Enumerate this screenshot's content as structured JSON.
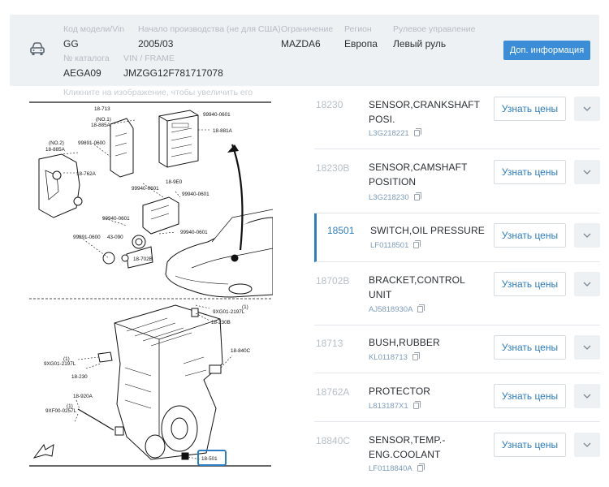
{
  "header": {
    "icon": "car-icon",
    "fields": [
      {
        "id": "model_code",
        "label": "Код модели/Vin",
        "value": "GG"
      },
      {
        "id": "production_start",
        "label": "Начало производства (не для США)",
        "value": "2005/03"
      },
      {
        "id": "restriction",
        "label": "Ограничение",
        "value": "MAZDA6"
      },
      {
        "id": "region",
        "label": "Регион",
        "value": "Европа"
      },
      {
        "id": "steering",
        "label": "Рулевое управление",
        "value": "Левый руль"
      },
      {
        "id": "catalog_no",
        "label": "№ каталога",
        "value": "AEGA09"
      },
      {
        "id": "vin",
        "label": "VIN / FRAME",
        "value": "JMZGG12F781717078"
      }
    ],
    "more_info_button": "Доп. информация",
    "accent_color": "#3a8dd6"
  },
  "diagram": {
    "hint": "Кликните на изображение, чтобы увеличить его",
    "highlighted_callout": "18-501",
    "callouts": [
      "18-713",
      "99940-0601",
      "(NO.1)",
      "18-885A",
      "18-881A",
      "(NO.2)",
      "18-885A",
      "99891-0600",
      "18-762A",
      "18-9E0",
      "99940-0601",
      "99940-0601",
      "99940-0601",
      "99940-0601",
      "99891-0600",
      "43-090",
      "18-702B",
      "9XG01-2197L",
      "18-230B",
      "9XG01-2197L",
      "18-230",
      "18-840C",
      "18-920A",
      "9XF00-0257L",
      "18-501"
    ],
    "callout_marks": [
      "(1)",
      "(1)",
      "(1)",
      "(1)"
    ]
  },
  "parts": [
    {
      "code": "18230",
      "name": "SENSOR,CRANKSHAFT POSI.",
      "part_no": "L3G218221",
      "price_button": "Узнать цены",
      "active": false
    },
    {
      "code": "18230B",
      "name": "SENSOR,CAMSHAFT POSITION",
      "part_no": "L3G218230",
      "price_button": "Узнать цены",
      "active": false
    },
    {
      "code": "18501",
      "name": "SWITCH,OIL PRESSURE",
      "part_no": "LF0118501",
      "price_button": "Узнать цены",
      "active": true
    },
    {
      "code": "18702B",
      "name": "BRACKET,CONTROL UNIT",
      "part_no": "AJ5818930A",
      "price_button": "Узнать цены",
      "active": false
    },
    {
      "code": "18713",
      "name": "BUSH,RUBBER",
      "part_no": "KL0118713",
      "price_button": "Узнать цены",
      "active": false
    },
    {
      "code": "18762A",
      "name": "PROTECTOR",
      "part_no": "L813187X1",
      "price_button": "Узнать цены",
      "active": false
    },
    {
      "code": "18840C",
      "name": "SENSOR,TEMP.-ENG.COOLANT",
      "part_no": "LF0118840A",
      "price_button": "Узнать цены",
      "active": false
    }
  ]
}
